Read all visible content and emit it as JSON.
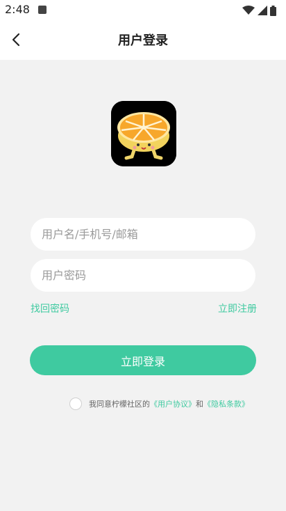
{
  "status_bar": {
    "time": "2:48"
  },
  "header": {
    "title": "用户登录",
    "back_icon": "chevron-left-icon"
  },
  "logo": {
    "icon": "orange-mascot-logo"
  },
  "form": {
    "username_placeholder": "用户名/手机号/邮箱",
    "username_value": "",
    "password_placeholder": "用户密码",
    "password_value": ""
  },
  "links": {
    "forgot_password": "找回密码",
    "register": "立即注册"
  },
  "login_button": "立即登录",
  "agreement": {
    "prefix": "我同意柠檬社区的",
    "user_agreement": "《用户协议》",
    "conjunction": "和",
    "privacy_policy": "《隐私条款》",
    "checked": false
  },
  "colors": {
    "accent": "#3fcaa0",
    "background": "#f2f2f2"
  }
}
